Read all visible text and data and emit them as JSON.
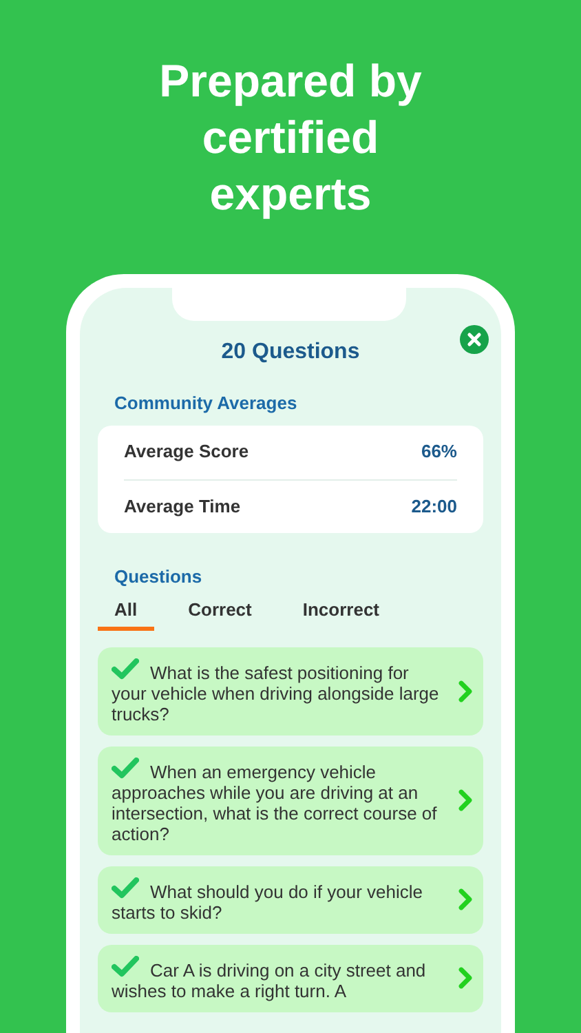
{
  "headline": "Prepared by certified experts",
  "screen": {
    "title": "20 Questions",
    "averages": {
      "heading": "Community Averages",
      "rows": [
        {
          "label": "Average Score",
          "value": "66%"
        },
        {
          "label": "Average Time",
          "value": "22:00"
        }
      ]
    },
    "questions_heading": "Questions",
    "tabs": [
      {
        "label": "All",
        "selected": true
      },
      {
        "label": "Correct",
        "selected": false
      },
      {
        "label": "Incorrect",
        "selected": false
      }
    ],
    "questions": [
      {
        "text": "What is the safest positioning for your vehicle when driving alongside large trucks?",
        "correct": true
      },
      {
        "text": "When an emergency vehicle approaches while you are driving at an intersection, what is the correct course of action?",
        "correct": true
      },
      {
        "text": "What should you do if your vehicle starts to skid?",
        "correct": true
      },
      {
        "text": "Car A is driving on a city street and wishes to make a right turn. A",
        "correct": true
      }
    ]
  }
}
